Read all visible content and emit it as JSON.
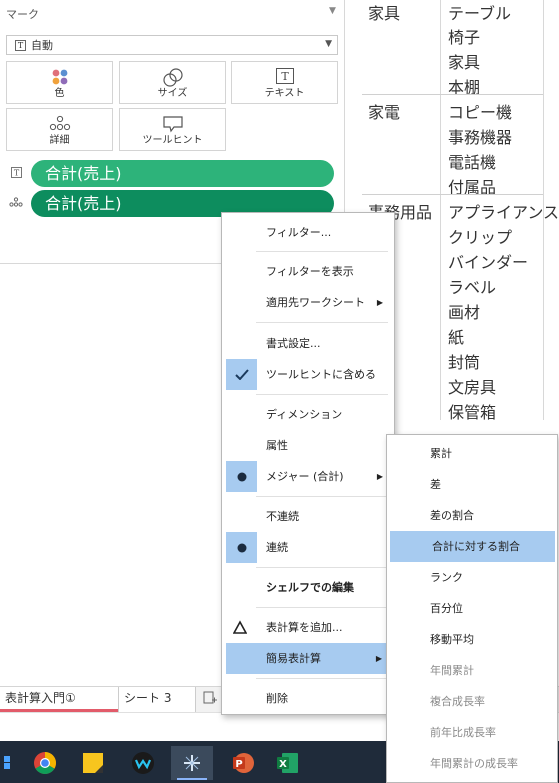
{
  "marks": {
    "title": "マーク",
    "mark_type": "自動",
    "buttons": {
      "color": "色",
      "size": "サイズ",
      "text": "テキスト",
      "detail": "詳細",
      "tooltip": "ツールヒント"
    },
    "pills": [
      "合計(売上)",
      "合計(売上)"
    ],
    "colors": {
      "pill_light": "#2db37a",
      "pill_dark": "#0d8d5e"
    }
  },
  "table": {
    "groups": [
      {
        "category": "家具",
        "items": [
          "テーブル",
          "椅子",
          "家具",
          "本棚"
        ]
      },
      {
        "category": "家電",
        "items": [
          "コピー機",
          "事務機器",
          "電話機",
          "付属品"
        ]
      },
      {
        "category": "事務用品",
        "items": [
          "アプライアンス",
          "クリップ",
          "バインダー",
          "ラベル",
          "画材",
          "紙",
          "封筒",
          "文房具",
          "保管箱"
        ]
      }
    ]
  },
  "tabs": {
    "active": "表計算入門①",
    "second": "シート 3"
  },
  "context_menu": {
    "filter": "フィルター...",
    "show_filter": "フィルターを表示",
    "apply_to": "適用先ワークシート",
    "format": "書式設定...",
    "include_tooltip": "ツールヒントに含める",
    "dimension": "ディメンション",
    "attribute": "属性",
    "measure": "メジャー (合計)",
    "discrete": "不連続",
    "continuous": "連続",
    "edit_shelf": "シェルフでの編集",
    "add_calc": "表計算を追加...",
    "quick_calc": "簡易表計算",
    "remove": "削除"
  },
  "submenu": {
    "items": [
      {
        "label": "累計",
        "enabled": true
      },
      {
        "label": "差",
        "enabled": true
      },
      {
        "label": "差の割合",
        "enabled": true
      },
      {
        "label": "合計に対する割合",
        "enabled": true,
        "highlighted": true
      },
      {
        "label": "ランク",
        "enabled": true
      },
      {
        "label": "百分位",
        "enabled": true
      },
      {
        "label": "移動平均",
        "enabled": true
      },
      {
        "label": "年間累計",
        "enabled": false
      },
      {
        "label": "複合成長率",
        "enabled": false
      },
      {
        "label": "前年比成長率",
        "enabled": false
      },
      {
        "label": "年間累計の成長率",
        "enabled": false
      }
    ]
  },
  "taskbar": {
    "icons": [
      "windows-icon",
      "chrome-icon",
      "sticky-notes-icon",
      "webex-icon",
      "tableau-icon",
      "powerpoint-icon",
      "excel-icon"
    ]
  }
}
